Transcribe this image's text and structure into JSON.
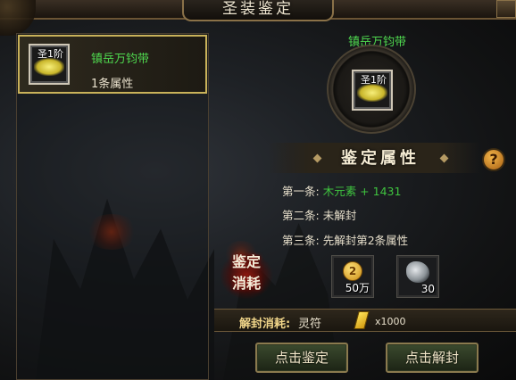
{
  "window": {
    "title": "圣装鉴定"
  },
  "item_list": [
    {
      "name": "镇岳万钧带",
      "tier": "圣1阶",
      "attr_count": "1条属性",
      "icon": "belt-icon"
    }
  ],
  "selected_item": {
    "name": "镇岳万钧带",
    "tier": "圣1阶"
  },
  "section": {
    "title": "鉴定属性",
    "help_glyph": "?"
  },
  "attributes": [
    {
      "label": "第一条:",
      "value": "木元素  +  1431"
    },
    {
      "label": "第二条:",
      "value": "未解封"
    },
    {
      "label": "第三条:",
      "value": "先解封第2条属性"
    }
  ],
  "cost": {
    "label_line1": "鉴定",
    "label_line2": "消耗",
    "gold": "50万",
    "ore": "30"
  },
  "unseal": {
    "label": "解封消耗:",
    "item": "灵符",
    "quantity": "x1000"
  },
  "buttons": {
    "identify": "点击鉴定",
    "unseal": "点击解封"
  },
  "colors": {
    "green_text": "#4fd94f",
    "gold_border": "#c9b25a"
  }
}
